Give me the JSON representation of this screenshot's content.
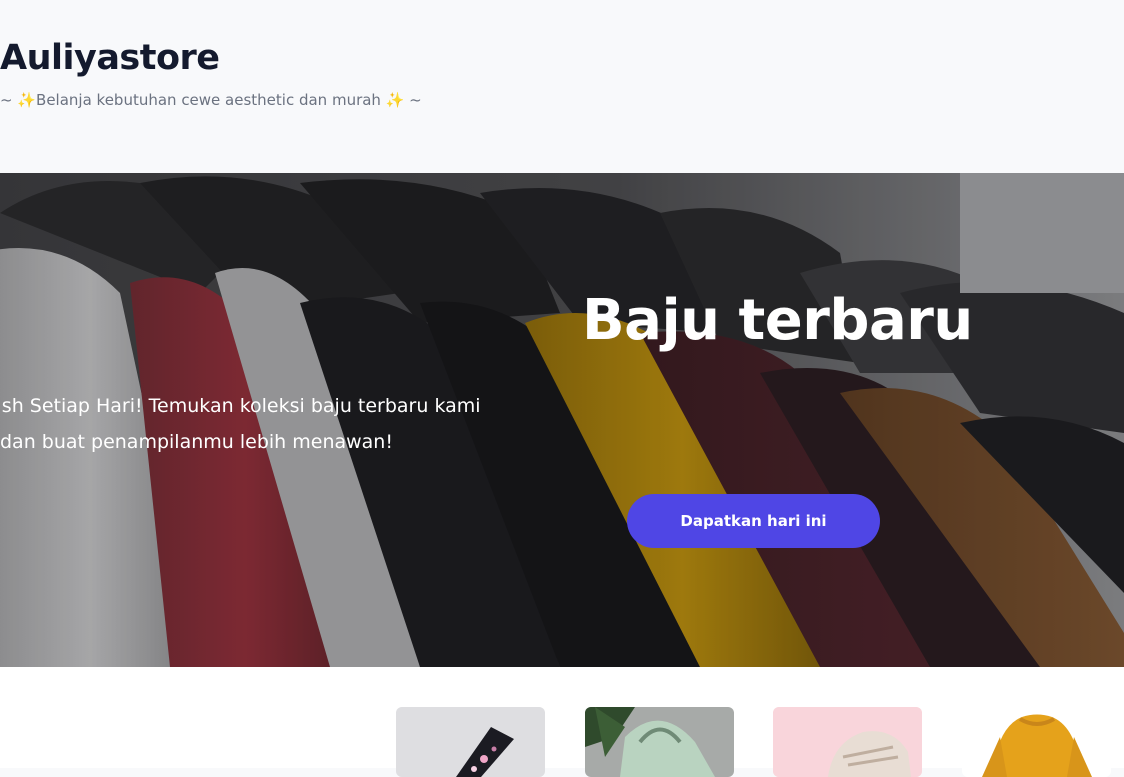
{
  "header": {
    "brand": "Auliyastore",
    "tagline_prefix": "~ ",
    "tagline_text": "Belanja kebutuhan cewe aesthetic dan murah ",
    "tagline_suffix": " ~",
    "sparkle": "✨"
  },
  "hero": {
    "title": "Baju terbaru",
    "description_line1": "ylish Setiap Hari! Temukan koleksi baju terbaru kami",
    "description_line2": "dan buat penampilanmu lebih menawan!",
    "cta_label": "Dapatkan hari ini",
    "image_subject": "clothes-on-hangers-image"
  },
  "products": [
    {
      "name": "phone-case-product-image"
    },
    {
      "name": "green-bag-product-image"
    },
    {
      "name": "sneaker-product-image"
    },
    {
      "name": "yellow-sweater-product-image"
    }
  ],
  "colors": {
    "brand_text": "#141a2e",
    "tagline_text": "#6b7280",
    "accent": "#4f46e5",
    "sparkle": "#f5b820"
  }
}
